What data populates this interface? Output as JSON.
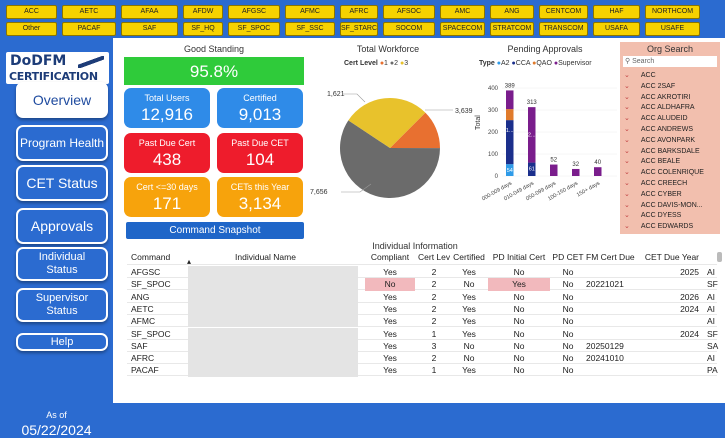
{
  "commands_row1": [
    "ACC",
    "AETC",
    "AFAA",
    "AFDW",
    "AFGSC",
    "AFMC",
    "AFRC",
    "AFSOC",
    "AMC",
    "ANG",
    "CENTCOM",
    "HAF",
    "NORTHCOM"
  ],
  "commands_row2": [
    "Other",
    "PACAF",
    "SAF",
    "SF_HQ",
    "SF_SPOC",
    "SF_SSC",
    "SF_STARC...",
    "SOCOM",
    "SPACECOM",
    "STRATCOM",
    "TRANSCOM",
    "USAFA",
    "USAFE"
  ],
  "logo": {
    "line1": "DoDFM",
    "line2": "CERTIFICATION"
  },
  "nav": [
    "Overview",
    "Program Health",
    "CET Status",
    "Approvals",
    "Individual Status",
    "Supervisor Status",
    "Help"
  ],
  "asof": {
    "label": "As of",
    "date": "05/22/2024"
  },
  "good_standing": {
    "title": "Good Standing",
    "value": "95.8%"
  },
  "kpis": {
    "total_users": {
      "label": "Total Users",
      "value": "12,916"
    },
    "certified": {
      "label": "Certified",
      "value": "9,013"
    },
    "past_due_cert": {
      "label": "Past Due Cert",
      "value": "438"
    },
    "past_due_cet": {
      "label": "Past Due CET",
      "value": "104"
    },
    "cert_30": {
      "label": "Cert <=30 days",
      "value": "171"
    },
    "cets_year": {
      "label": "CETs this Year",
      "value": "3,134"
    }
  },
  "snapshot_button": "Command Snapshot",
  "workforce": {
    "title": "Total Workforce",
    "legend_title": "Cert Level",
    "legend": [
      "1",
      "2",
      "3"
    ],
    "labels": [
      "1,621",
      "3,639",
      "7,656"
    ]
  },
  "pending": {
    "title": "Pending Approvals",
    "legend_title": "Type",
    "legend": [
      "A2",
      "CCA",
      "QAO",
      "Supervisor"
    ],
    "ylabel": "Total",
    "yticks": [
      "400",
      "300",
      "200",
      "100",
      "0"
    ],
    "xticks": [
      "000-009 days",
      "010-049 days",
      "050-099 days",
      "100-150 days",
      "150+ days"
    ]
  },
  "chart_data": [
    {
      "type": "pie",
      "title": "Total Workforce",
      "legend_title": "Cert Level",
      "categories": [
        "1",
        "2",
        "3"
      ],
      "values": [
        1621,
        7656,
        3639
      ],
      "colors": [
        "#e87030",
        "#6b6b6b",
        "#e8c22c"
      ]
    },
    {
      "type": "bar",
      "title": "Pending Approvals",
      "legend_title": "Type",
      "ylabel": "Total",
      "ylim": [
        0,
        400
      ],
      "stacked": true,
      "categories": [
        "000-009 days",
        "000-009 days",
        "010-049 days",
        "010-049 days",
        "050-099 days",
        "050-099 days",
        "100-150 days",
        "100-150 days",
        "150+ days",
        "150+ days"
      ],
      "series": [
        {
          "name": "A2",
          "color": "#2f9be8",
          "values": [
            54,
            0,
            0,
            0,
            0,
            0,
            0,
            0,
            0,
            0
          ]
        },
        {
          "name": "CCA",
          "color": "#1b2f8c",
          "values": [
            200,
            0,
            61,
            0,
            0,
            0,
            0,
            0,
            0,
            0
          ]
        },
        {
          "name": "QAO",
          "color": "#e07b2c",
          "values": [
            50,
            0,
            0,
            0,
            0,
            0,
            0,
            0,
            0,
            0
          ]
        },
        {
          "name": "Supervisor",
          "color": "#7a1d8c",
          "values": [
            85,
            0,
            252,
            0,
            52,
            0,
            32,
            0,
            40,
            0
          ]
        }
      ],
      "bar_totals": [
        "389",
        "",
        "313",
        "",
        "52",
        "",
        "32",
        "",
        "40",
        ""
      ],
      "segment_labels": [
        "1...",
        "2..."
      ]
    }
  ],
  "org_search": {
    "title": "Org Search",
    "placeholder": "Search",
    "items": [
      "ACC",
      "ACC 2SAF",
      "ACC AKROTIRI",
      "ACC ALDHAFRA",
      "ACC ALUDEID",
      "ACC ANDREWS",
      "ACC AVONPARK",
      "ACC BARKSDALE",
      "ACC BEALE",
      "ACC COLENRIQUE",
      "ACC CREECH",
      "ACC CYBER",
      "ACC DAVIS-MON...",
      "ACC DYESS",
      "ACC EDWARDS"
    ]
  },
  "individual": {
    "title": "Individual Information",
    "headers": [
      "Command",
      "Individual Name",
      "Compliant",
      "Cert Level",
      "Certified",
      "PD Initial Cert",
      "PD CET",
      "FM Cert Due",
      "CET Due Year",
      ""
    ],
    "rows": [
      [
        "AFGSC",
        "",
        "Yes",
        "2",
        "Yes",
        "No",
        "No",
        "",
        "2025",
        "AI"
      ],
      [
        "SF_SPOC",
        "",
        "No",
        "2",
        "No",
        "Yes",
        "No",
        "20221021",
        "",
        "SF"
      ],
      [
        "ANG",
        "",
        "Yes",
        "2",
        "Yes",
        "No",
        "No",
        "",
        "2026",
        "AI"
      ],
      [
        "AETC",
        "",
        "Yes",
        "2",
        "Yes",
        "No",
        "No",
        "",
        "2024",
        "AI"
      ],
      [
        "AFMC",
        "",
        "Yes",
        "2",
        "Yes",
        "No",
        "No",
        "",
        "",
        "AI"
      ],
      [
        "SF_SPOC",
        "",
        "Yes",
        "1",
        "Yes",
        "No",
        "No",
        "",
        "2024",
        "SF"
      ],
      [
        "SAF",
        "",
        "Yes",
        "3",
        "No",
        "No",
        "No",
        "20250129",
        "",
        "SA"
      ],
      [
        "AFRC",
        "",
        "Yes",
        "2",
        "No",
        "No",
        "No",
        "20241010",
        "",
        "AI"
      ],
      [
        "PACAF",
        "",
        "Yes",
        "1",
        "Yes",
        "No",
        "No",
        "",
        "",
        "PA"
      ]
    ]
  }
}
